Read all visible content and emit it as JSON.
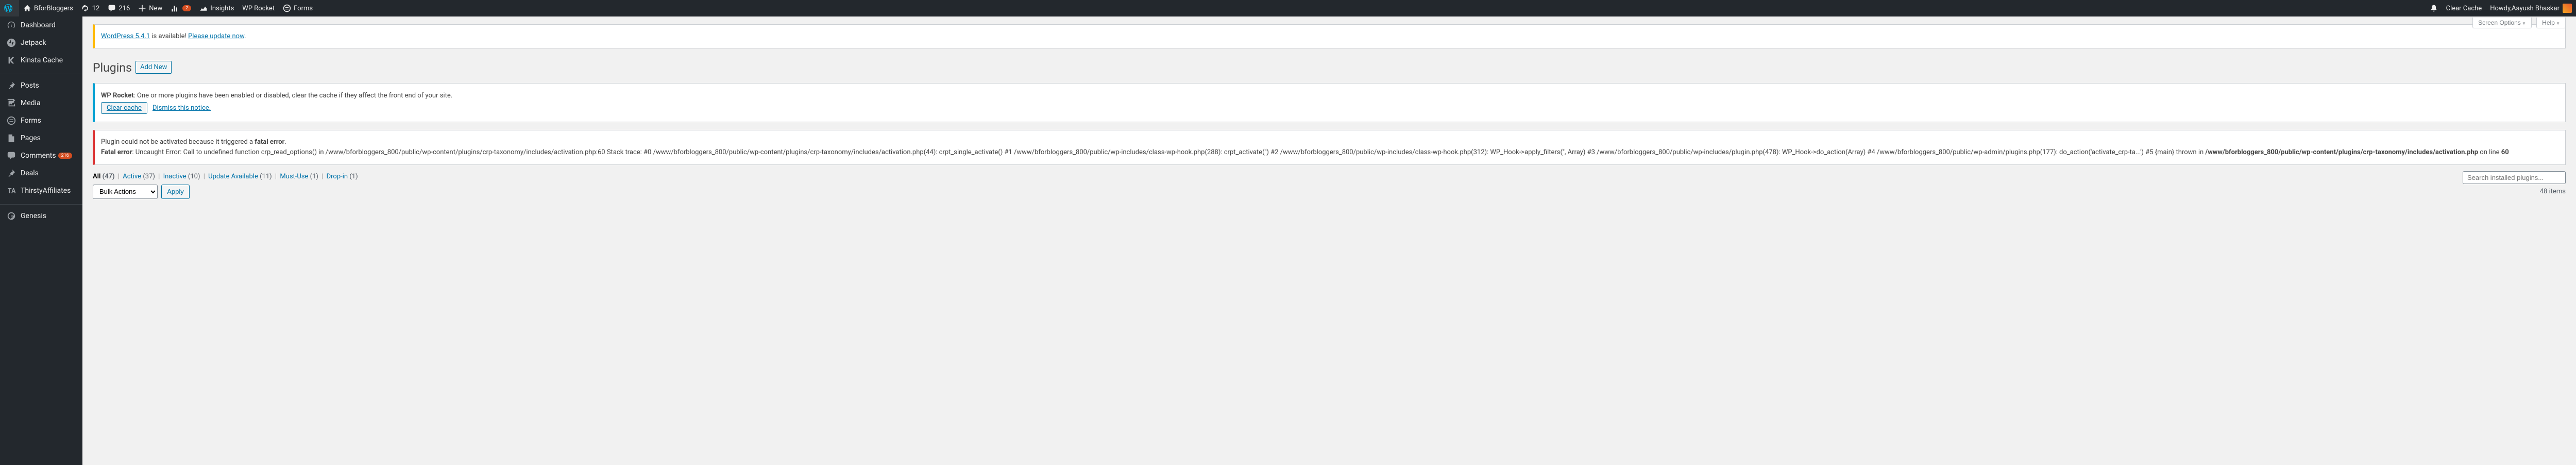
{
  "adminbar": {
    "site_name": "BforBloggers",
    "updates_count": "12",
    "comments_count": "216",
    "new_label": "New",
    "stats_badge": "2",
    "insights_label": "Insights",
    "wprocket_label": "WP Rocket",
    "forms_label": "Forms",
    "clear_cache_label": "Clear Cache",
    "howdy_prefix": "Howdy, ",
    "user_name": "Aayush Bhaskar"
  },
  "menu": {
    "dashboard": "Dashboard",
    "jetpack": "Jetpack",
    "kinsta": "Kinsta Cache",
    "posts": "Posts",
    "media": "Media",
    "forms": "Forms",
    "pages": "Pages",
    "comments": "Comments",
    "comments_count": "216",
    "deals": "Deals",
    "thirsty": "ThirstyAffiliates",
    "genesis": "Genesis"
  },
  "screen_meta": {
    "screen_options": "Screen Options",
    "help": "Help"
  },
  "update_nag": {
    "prefix": "WordPress 5.4.1",
    "middle": " is available! ",
    "link": "Please update now"
  },
  "heading": {
    "title": "Plugins",
    "add_new": "Add New"
  },
  "rocket_notice": {
    "strong": "WP Rocket",
    "text": ": One or more plugins have been enabled or disabled, clear the cache if they affect the front end of your site.",
    "clear_btn": "Clear cache",
    "dismiss": "Dismiss this notice."
  },
  "error_notice": {
    "line1_a": "Plugin could not be activated because it triggered a ",
    "line1_b": "fatal error",
    "fatal_label": "Fatal error",
    "msg_a": ": Uncaught Error: Call to undefined function crp_read_options() in /www/bforbloggers_800/public/wp-content/plugins/crp-taxonomy/includes/activation.php:60 Stack trace: #0 /www/bforbloggers_800/public/wp-content/plugins/crp-taxonomy/includes/activation.php(44): crpt_single_activate() #1 /www/bforbloggers_800/public/wp-includes/class-wp-hook.php(288): crpt_activate('') #2 /www/bforbloggers_800/public/wp-includes/class-wp-hook.php(312): WP_Hook->apply_filters('', Array) #3 /www/bforbloggers_800/public/wp-includes/plugin.php(478): WP_Hook->do_action(Array) #4 /www/bforbloggers_800/public/wp-admin/plugins.php(177): do_action('activate_crp-ta...') #5 {main} thrown in ",
    "msg_path": "/www/bforbloggers_800/public/wp-content/plugins/crp-taxonomy/includes/activation.php",
    "msg_online": " on line ",
    "msg_line": "60"
  },
  "filters": {
    "all_label": "All ",
    "all_count": "(47)",
    "active_label": "Active ",
    "active_count": "(37)",
    "inactive_label": "Inactive ",
    "inactive_count": "(10)",
    "update_label": "Update Available ",
    "update_count": "(11)",
    "mustuse_label": "Must-Use ",
    "mustuse_count": "(1)",
    "dropin_label": "Drop-in ",
    "dropin_count": "(1)"
  },
  "search": {
    "placeholder": "Search installed plugins..."
  },
  "bulk": {
    "label": "Bulk Actions",
    "apply": "Apply"
  },
  "pagination": {
    "items": "48 items"
  }
}
